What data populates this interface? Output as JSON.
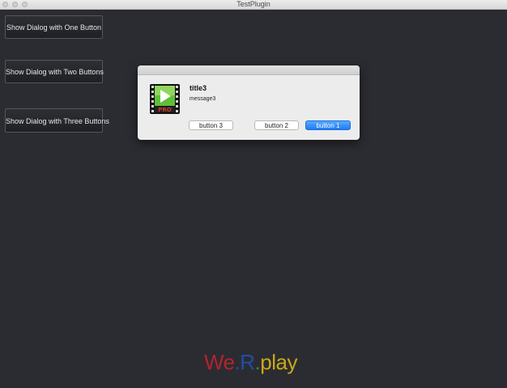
{
  "window": {
    "title": "TestPlugin"
  },
  "buttons": {
    "one": "Show Dialog with One Button",
    "two": "Show Dialog with Two Buttons",
    "three": "Show Dialog with Three Buttons"
  },
  "dialog": {
    "title": "title3",
    "message": "message3",
    "button3": "button 3",
    "button2": "button 2",
    "button1": "button 1",
    "icon": "video-player-icon",
    "accent_color": "#2d8cf7"
  },
  "logo": {
    "we": "We",
    "dot1": ".",
    "r": "R",
    "dot2": ".",
    "play": "play"
  },
  "colors": {
    "background": "#2b2c31",
    "logo_red": "#b3232e",
    "logo_blue": "#1f4fa8",
    "logo_green": "#2f8f3a",
    "logo_yellow": "#c9a818"
  }
}
